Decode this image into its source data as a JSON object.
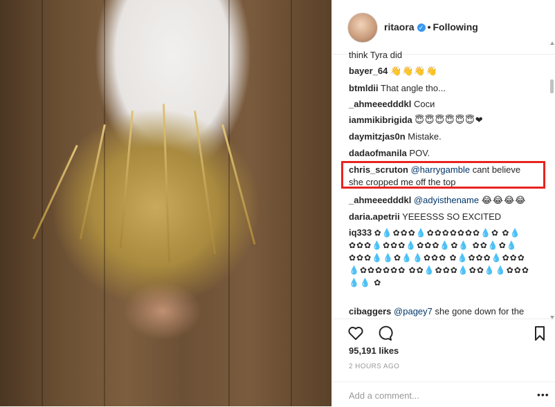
{
  "post": {
    "image_alt": "photo of a blonde woman seen from above on a wooden floor"
  },
  "header": {
    "username": "ritaora",
    "verified_mark": "✓",
    "separator": "•",
    "follow_label": "Following"
  },
  "comments": [
    {
      "user": "think Tyra did",
      "text": ""
    },
    {
      "user": "bayer_64",
      "text": "👋👋👋👋"
    },
    {
      "user": "btmldii",
      "text": "That angle tho..."
    },
    {
      "user": "_ahmeeedddkl",
      "text": "Соси"
    },
    {
      "user": "iammikibrigida",
      "text": "😇😇😇😇😇😇❤"
    },
    {
      "user": "daymitzjas0n",
      "text": "Mistake."
    },
    {
      "user": "dadaofmanila",
      "text": "POV."
    },
    {
      "user": "chris_scruton",
      "mention": "@harrygamble",
      "text": "cant believe she cropped me off the top"
    },
    {
      "user": "_ahmeeedddkl",
      "mention": "@adyisthename",
      "text": "😂😂😂😂"
    },
    {
      "user": "daria.apetrii",
      "text": "YEEESSS SO EXCITED"
    },
    {
      "user": "iq333",
      "text": "✿💧✿✿✿💧✿✿✿✿✿✿✿💧✿ ✿💧✿✿✿💧✿✿✿💧✿✿✿💧✿💧 ✿✿💧✿💧✿✿✿💧💧✿💧💧✿✿✿ ✿💧✿✿✿💧✿✿✿💧✿✿✿✿✿✿ ✿✿💧✿✿✿💧✿✿💧💧✿✿✿💧💧 ✿"
    },
    {
      "user": "cibaggers",
      "mention": "@pagey7",
      "text": "she gone down for the"
    }
  ],
  "actions": {
    "like_icon": "heart-icon",
    "comment_icon": "comment-icon",
    "save_icon": "bookmark-icon"
  },
  "likes_text": "95,191 likes",
  "time_text": "2 HOURS AGO",
  "comment_box": {
    "placeholder": "Add a comment...",
    "more_label": "•••"
  },
  "colors": {
    "highlight": "#e8231e",
    "mention": "#003569",
    "verified": "#3897f0"
  }
}
